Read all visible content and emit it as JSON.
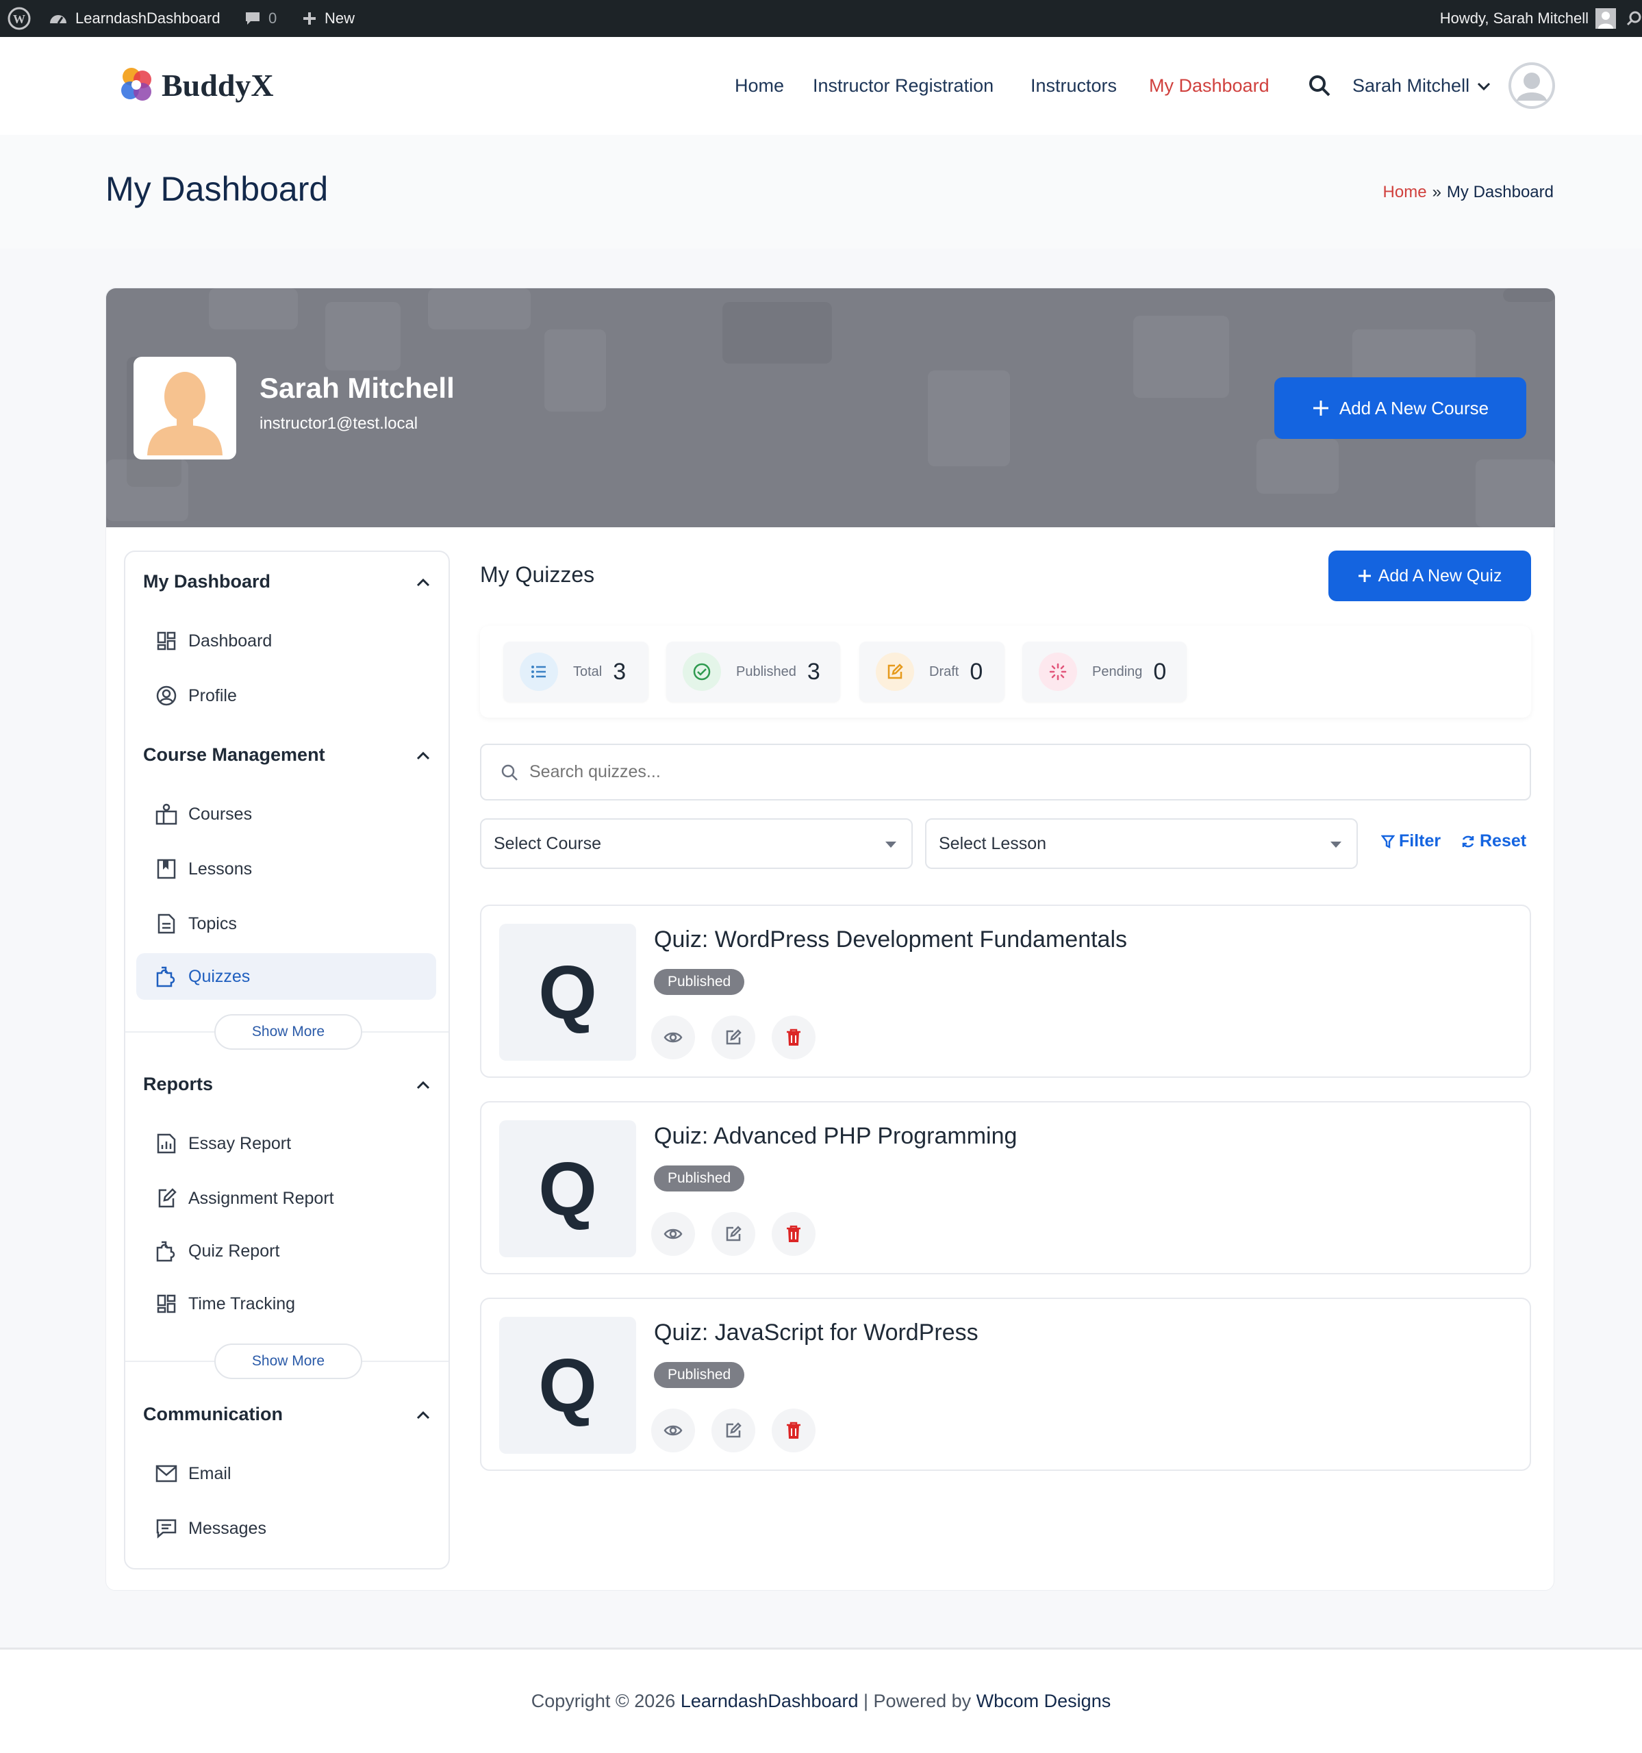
{
  "admin_bar": {
    "site_name": "LearndashDashboard",
    "comments_count": "0",
    "new_label": "New",
    "howdy": "Howdy, Sarah Mitchell"
  },
  "header": {
    "logo_text": "BuddyX",
    "nav": [
      "Home",
      "Instructor Registration",
      "Instructors",
      "My Dashboard"
    ],
    "active_nav": "My Dashboard",
    "user_name": "Sarah Mitchell"
  },
  "page": {
    "title": "My Dashboard",
    "breadcrumb_home": "Home",
    "breadcrumb_sep": "»",
    "breadcrumb_current": "My Dashboard"
  },
  "profile": {
    "name": "Sarah Mitchell",
    "email": "instructor1@test.local",
    "add_course_label": "Add A New Course"
  },
  "sidebar": {
    "sections": [
      {
        "title": "My Dashboard",
        "items": [
          "Dashboard",
          "Profile"
        ]
      },
      {
        "title": "Course Management",
        "items": [
          "Courses",
          "Lessons",
          "Topics",
          "Quizzes"
        ],
        "show_more": "Show More"
      },
      {
        "title": "Reports",
        "items": [
          "Essay Report",
          "Assignment Report",
          "Quiz Report",
          "Time Tracking"
        ],
        "show_more": "Show More"
      },
      {
        "title": "Communication",
        "items": [
          "Email",
          "Messages"
        ]
      }
    ],
    "active_item": "Quizzes"
  },
  "main": {
    "title": "My Quizzes",
    "add_quiz_label": "Add A New Quiz",
    "stats": [
      {
        "label": "Total",
        "value": "3"
      },
      {
        "label": "Published",
        "value": "3"
      },
      {
        "label": "Draft",
        "value": "0"
      },
      {
        "label": "Pending",
        "value": "0"
      }
    ],
    "search_placeholder": "Search quizzes...",
    "select_course": "Select Course",
    "select_lesson": "Select Lesson",
    "filter_label": "Filter",
    "reset_label": "Reset",
    "quizzes": [
      {
        "thumb": "Q",
        "title": "Quiz: WordPress Development Fundamentals",
        "status": "Published"
      },
      {
        "thumb": "Q",
        "title": "Quiz: Advanced PHP Programming",
        "status": "Published"
      },
      {
        "thumb": "Q",
        "title": "Quiz: JavaScript for WordPress",
        "status": "Published"
      }
    ]
  },
  "footer": {
    "prefix": "Copyright © 2026",
    "site_link": "LearndashDashboard",
    "middle": "| Powered by",
    "designer_link": "Wbcom Designs"
  },
  "colors": {
    "accent_blue": "#1464e0",
    "active_red": "#d0403d",
    "badge_gray": "#7c7e86",
    "banner_gray": "#7c7e86"
  }
}
